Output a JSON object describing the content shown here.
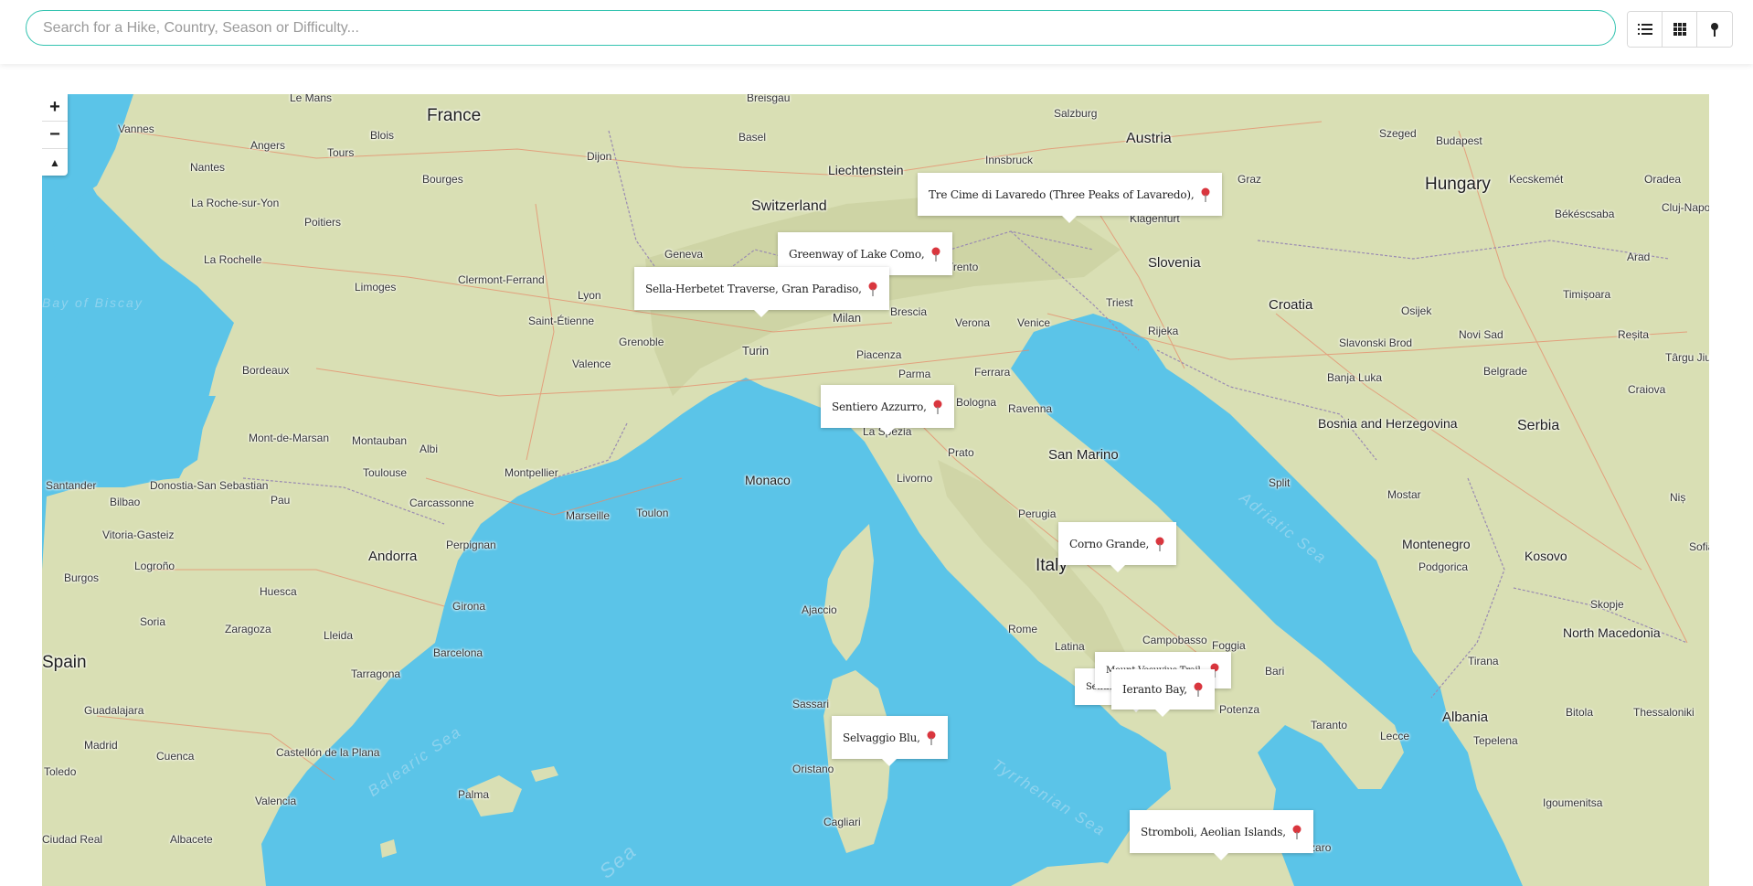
{
  "search": {
    "placeholder": "Search for a Hike, Country, Season or Difficulty..."
  },
  "view_buttons": [
    {
      "icon": "list-icon"
    },
    {
      "icon": "grid-icon"
    },
    {
      "icon": "map-pin-icon"
    }
  ],
  "map": {
    "zoom_in": "+",
    "zoom_out": "−",
    "reset_north": "▲",
    "countries": [
      "France",
      "Switzerland",
      "Liechtenstein",
      "Austria",
      "Hungary",
      "Slovenia",
      "Croatia",
      "Bosnia and Herzegovina",
      "Serbia",
      "Montenegro",
      "Kosovo",
      "North Macedonia",
      "Albania",
      "Italy",
      "Spain",
      "Andorra",
      "San Marino",
      "Monaco"
    ],
    "seas": [
      "Adriatic Sea",
      "Balearic Sea",
      "Tyrrhenian Sea",
      "Sea",
      "Bay of Biscay"
    ],
    "cities": [
      "Vannes",
      "Le Mans",
      "Nantes",
      "Angers",
      "Tours",
      "Blois",
      "La Roche-sur-Yon",
      "Poitiers",
      "Bourges",
      "Dijon",
      "Basel",
      "Breisgau",
      "Salzburg",
      "Innsbruck",
      "Budapest",
      "Graz",
      "Klagenfurt",
      "Trento",
      "Geneva",
      "Lyon",
      "Limoges",
      "Clermont-Ferrand",
      "La Rochelle",
      "Saint-Étienne",
      "Grenoble",
      "Valence",
      "Bordeaux",
      "Mont-de-Marsan",
      "Montauban",
      "Albi",
      "Toulouse",
      "Montpellier",
      "Marseille",
      "Toulon",
      "Carcassonne",
      "Perpignan",
      "Santander",
      "Bilbao",
      "Donostia-San Sebastian",
      "Pau",
      "Vitoria-Gasteiz",
      "Logroño",
      "Burgos",
      "Huesca",
      "Girona",
      "Soria",
      "Zaragoza",
      "Lleida",
      "Barcelona",
      "Tarragona",
      "Guadalajara",
      "Madrid",
      "Cuenca",
      "Toledo",
      "Castellón de la Plana",
      "Palma",
      "Valencia",
      "Albacete",
      "Ciudad Real",
      "Milan",
      "Turin",
      "Brescia",
      "Verona",
      "Venice",
      "Triest",
      "Rijeka",
      "Piacenza",
      "Parma",
      "La Spezia",
      "Bologna",
      "Ferrara",
      "Ravenna",
      "Prato",
      "Livorno",
      "Perugia",
      "Rome",
      "Latina",
      "Campobasso",
      "Foggia",
      "Bari",
      "Taranto",
      "Lecce",
      "Potenza",
      "Ajaccio",
      "Sassari",
      "Oristano",
      "Cagliari",
      "Catanzaro",
      "Osijek",
      "Slavonski Brod",
      "Novi Sad",
      "Banja Luka",
      "Belgrade",
      "Mostar",
      "Split",
      "Podgorica",
      "Tirana",
      "Skopje",
      "Bitola",
      "Thessaloniki",
      "Igoumenitsa",
      "Tepelena",
      "Kecskemét",
      "Oradea",
      "Békéscsaba",
      "Arad",
      "Timișoara",
      "Reșita",
      "Târgu Jiu",
      "Craiova",
      "Niș",
      "Sofia",
      "Cluj-Napoca",
      "Szeged"
    ],
    "hikes": [
      "Tre Cime di Lavaredo (Three Peaks of Lavaredo),",
      "Greenway of Lake Como,",
      "Sella-Herbetet Traverse, Gran Paradiso,",
      "Sentiero Azzurro,",
      "Corno Grande,",
      "Mount Vesuvius Trail,",
      "Ieranto Bay,",
      "Sentiero degli Dei,",
      "Selvaggio Blu,",
      "Stromboli, Aeolian Islands,"
    ],
    "hike_pin_color": "#d9363e"
  },
  "colors": {
    "accent": "#33c3b0",
    "water": "#5bc4e8",
    "land": "#d9dfb4"
  }
}
